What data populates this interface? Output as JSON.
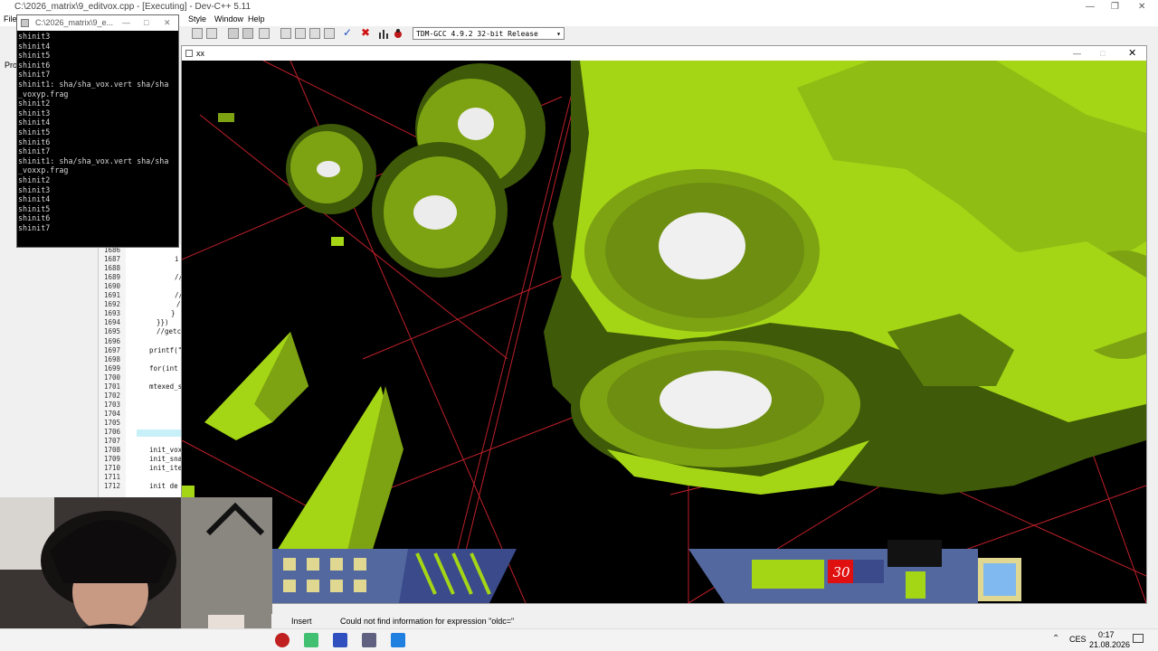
{
  "ide": {
    "title": "C:\\2026_matrix\\9_editvox.cpp - [Executing] - Dev-C++ 5.11",
    "menu": [
      "File",
      "Style",
      "Window",
      "Help"
    ],
    "compiler": "TDM-GCC 4.9.2 32-bit Release",
    "left_tab_fragment": "Pro",
    "line_numbers": [
      "1686",
      "1687",
      "1688",
      "1689",
      "1690",
      "1691",
      "1692",
      "1693",
      "1694",
      "1695",
      "1696",
      "1697",
      "1698",
      "1699",
      "1700",
      "1701",
      "1702",
      "1703",
      "1704",
      "1705",
      "1706",
      "1707",
      "1708",
      "1709",
      "1710",
      "1711",
      "1712"
    ],
    "code_fragments": [
      {
        "text": "i",
        "line": 1
      },
      {
        "text": "//",
        "line": 3
      },
      {
        "text": "//",
        "line": 5
      },
      {
        "text": "/",
        "line": 6
      },
      {
        "text": "}",
        "line": 7
      },
      {
        "text": "}})",
        "line": 8
      },
      {
        "text": "//getc",
        "line": 9
      },
      {
        "text": "printf(\"",
        "line": 11
      },
      {
        "text": "for(int",
        "line": 13
      },
      {
        "text": "mtexed_s",
        "line": 15
      },
      {
        "text": "init_vox",
        "line": 22
      },
      {
        "text": "init_sna",
        "line": 23
      },
      {
        "text": "init_ite",
        "line": 24
      },
      {
        "text": "init de",
        "line": 26
      }
    ]
  },
  "console": {
    "title": "C:\\2026_matrix\\9_e...",
    "lines": [
      "shinit3",
      "shinit4",
      "shinit5",
      "shinit6",
      "shinit7",
      "shinit1: sha/sha_vox.vert sha/sha",
      "_voxyp.frag",
      "shinit2",
      "shinit3",
      "shinit4",
      "shinit5",
      "shinit6",
      "shinit7",
      "shinit1: sha/sha_vox.vert sha/sha",
      "_voxxp.frag",
      "shinit2",
      "shinit3",
      "shinit4",
      "shinit5",
      "shinit6",
      "shinit7"
    ]
  },
  "game": {
    "title": "xx",
    "hud_value": "30"
  },
  "statusbar": {
    "mode": "Insert",
    "message": "Could not find information for expression \"oldc=\""
  },
  "taskbar": {
    "lang": "CES",
    "time": "0:17",
    "date": "21.08.2026"
  },
  "colors": {
    "voxel_light": "#a4d616",
    "voxel_mid": "#7ea312",
    "voxel_dark": "#3f5a08",
    "grid_red": "#c0202a",
    "hud_panel": "#5468a0",
    "hud_red": "#e01010"
  }
}
